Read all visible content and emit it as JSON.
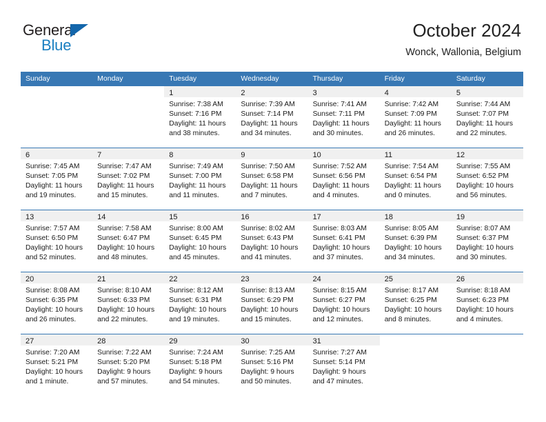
{
  "brand": {
    "name_part1": "General",
    "name_part2": "Blue",
    "triangle_color": "#1366ab",
    "blue_text_color": "#1a7fc1"
  },
  "header": {
    "title": "October 2024",
    "subtitle": "Wonck, Wallonia, Belgium"
  },
  "theme": {
    "header_row_color": "#3878b4",
    "week_divider_color": "#3878b4",
    "daynum_band_color": "#f0f0f0",
    "text_color": "#1a1a1a"
  },
  "calendar": {
    "weekday_headers": [
      "Sunday",
      "Monday",
      "Tuesday",
      "Wednesday",
      "Thursday",
      "Friday",
      "Saturday"
    ],
    "weeks": [
      [
        {
          "day": "",
          "sunrise": "",
          "sunset": "",
          "daylight_line1": "",
          "daylight_line2": ""
        },
        {
          "day": "",
          "sunrise": "",
          "sunset": "",
          "daylight_line1": "",
          "daylight_line2": ""
        },
        {
          "day": "1",
          "sunrise": "Sunrise: 7:38 AM",
          "sunset": "Sunset: 7:16 PM",
          "daylight_line1": "Daylight: 11 hours",
          "daylight_line2": "and 38 minutes."
        },
        {
          "day": "2",
          "sunrise": "Sunrise: 7:39 AM",
          "sunset": "Sunset: 7:14 PM",
          "daylight_line1": "Daylight: 11 hours",
          "daylight_line2": "and 34 minutes."
        },
        {
          "day": "3",
          "sunrise": "Sunrise: 7:41 AM",
          "sunset": "Sunset: 7:11 PM",
          "daylight_line1": "Daylight: 11 hours",
          "daylight_line2": "and 30 minutes."
        },
        {
          "day": "4",
          "sunrise": "Sunrise: 7:42 AM",
          "sunset": "Sunset: 7:09 PM",
          "daylight_line1": "Daylight: 11 hours",
          "daylight_line2": "and 26 minutes."
        },
        {
          "day": "5",
          "sunrise": "Sunrise: 7:44 AM",
          "sunset": "Sunset: 7:07 PM",
          "daylight_line1": "Daylight: 11 hours",
          "daylight_line2": "and 22 minutes."
        }
      ],
      [
        {
          "day": "6",
          "sunrise": "Sunrise: 7:45 AM",
          "sunset": "Sunset: 7:05 PM",
          "daylight_line1": "Daylight: 11 hours",
          "daylight_line2": "and 19 minutes."
        },
        {
          "day": "7",
          "sunrise": "Sunrise: 7:47 AM",
          "sunset": "Sunset: 7:02 PM",
          "daylight_line1": "Daylight: 11 hours",
          "daylight_line2": "and 15 minutes."
        },
        {
          "day": "8",
          "sunrise": "Sunrise: 7:49 AM",
          "sunset": "Sunset: 7:00 PM",
          "daylight_line1": "Daylight: 11 hours",
          "daylight_line2": "and 11 minutes."
        },
        {
          "day": "9",
          "sunrise": "Sunrise: 7:50 AM",
          "sunset": "Sunset: 6:58 PM",
          "daylight_line1": "Daylight: 11 hours",
          "daylight_line2": "and 7 minutes."
        },
        {
          "day": "10",
          "sunrise": "Sunrise: 7:52 AM",
          "sunset": "Sunset: 6:56 PM",
          "daylight_line1": "Daylight: 11 hours",
          "daylight_line2": "and 4 minutes."
        },
        {
          "day": "11",
          "sunrise": "Sunrise: 7:54 AM",
          "sunset": "Sunset: 6:54 PM",
          "daylight_line1": "Daylight: 11 hours",
          "daylight_line2": "and 0 minutes."
        },
        {
          "day": "12",
          "sunrise": "Sunrise: 7:55 AM",
          "sunset": "Sunset: 6:52 PM",
          "daylight_line1": "Daylight: 10 hours",
          "daylight_line2": "and 56 minutes."
        }
      ],
      [
        {
          "day": "13",
          "sunrise": "Sunrise: 7:57 AM",
          "sunset": "Sunset: 6:50 PM",
          "daylight_line1": "Daylight: 10 hours",
          "daylight_line2": "and 52 minutes."
        },
        {
          "day": "14",
          "sunrise": "Sunrise: 7:58 AM",
          "sunset": "Sunset: 6:47 PM",
          "daylight_line1": "Daylight: 10 hours",
          "daylight_line2": "and 48 minutes."
        },
        {
          "day": "15",
          "sunrise": "Sunrise: 8:00 AM",
          "sunset": "Sunset: 6:45 PM",
          "daylight_line1": "Daylight: 10 hours",
          "daylight_line2": "and 45 minutes."
        },
        {
          "day": "16",
          "sunrise": "Sunrise: 8:02 AM",
          "sunset": "Sunset: 6:43 PM",
          "daylight_line1": "Daylight: 10 hours",
          "daylight_line2": "and 41 minutes."
        },
        {
          "day": "17",
          "sunrise": "Sunrise: 8:03 AM",
          "sunset": "Sunset: 6:41 PM",
          "daylight_line1": "Daylight: 10 hours",
          "daylight_line2": "and 37 minutes."
        },
        {
          "day": "18",
          "sunrise": "Sunrise: 8:05 AM",
          "sunset": "Sunset: 6:39 PM",
          "daylight_line1": "Daylight: 10 hours",
          "daylight_line2": "and 34 minutes."
        },
        {
          "day": "19",
          "sunrise": "Sunrise: 8:07 AM",
          "sunset": "Sunset: 6:37 PM",
          "daylight_line1": "Daylight: 10 hours",
          "daylight_line2": "and 30 minutes."
        }
      ],
      [
        {
          "day": "20",
          "sunrise": "Sunrise: 8:08 AM",
          "sunset": "Sunset: 6:35 PM",
          "daylight_line1": "Daylight: 10 hours",
          "daylight_line2": "and 26 minutes."
        },
        {
          "day": "21",
          "sunrise": "Sunrise: 8:10 AM",
          "sunset": "Sunset: 6:33 PM",
          "daylight_line1": "Daylight: 10 hours",
          "daylight_line2": "and 22 minutes."
        },
        {
          "day": "22",
          "sunrise": "Sunrise: 8:12 AM",
          "sunset": "Sunset: 6:31 PM",
          "daylight_line1": "Daylight: 10 hours",
          "daylight_line2": "and 19 minutes."
        },
        {
          "day": "23",
          "sunrise": "Sunrise: 8:13 AM",
          "sunset": "Sunset: 6:29 PM",
          "daylight_line1": "Daylight: 10 hours",
          "daylight_line2": "and 15 minutes."
        },
        {
          "day": "24",
          "sunrise": "Sunrise: 8:15 AM",
          "sunset": "Sunset: 6:27 PM",
          "daylight_line1": "Daylight: 10 hours",
          "daylight_line2": "and 12 minutes."
        },
        {
          "day": "25",
          "sunrise": "Sunrise: 8:17 AM",
          "sunset": "Sunset: 6:25 PM",
          "daylight_line1": "Daylight: 10 hours",
          "daylight_line2": "and 8 minutes."
        },
        {
          "day": "26",
          "sunrise": "Sunrise: 8:18 AM",
          "sunset": "Sunset: 6:23 PM",
          "daylight_line1": "Daylight: 10 hours",
          "daylight_line2": "and 4 minutes."
        }
      ],
      [
        {
          "day": "27",
          "sunrise": "Sunrise: 7:20 AM",
          "sunset": "Sunset: 5:21 PM",
          "daylight_line1": "Daylight: 10 hours",
          "daylight_line2": "and 1 minute."
        },
        {
          "day": "28",
          "sunrise": "Sunrise: 7:22 AM",
          "sunset": "Sunset: 5:20 PM",
          "daylight_line1": "Daylight: 9 hours",
          "daylight_line2": "and 57 minutes."
        },
        {
          "day": "29",
          "sunrise": "Sunrise: 7:24 AM",
          "sunset": "Sunset: 5:18 PM",
          "daylight_line1": "Daylight: 9 hours",
          "daylight_line2": "and 54 minutes."
        },
        {
          "day": "30",
          "sunrise": "Sunrise: 7:25 AM",
          "sunset": "Sunset: 5:16 PM",
          "daylight_line1": "Daylight: 9 hours",
          "daylight_line2": "and 50 minutes."
        },
        {
          "day": "31",
          "sunrise": "Sunrise: 7:27 AM",
          "sunset": "Sunset: 5:14 PM",
          "daylight_line1": "Daylight: 9 hours",
          "daylight_line2": "and 47 minutes."
        },
        {
          "day": "",
          "sunrise": "",
          "sunset": "",
          "daylight_line1": "",
          "daylight_line2": ""
        },
        {
          "day": "",
          "sunrise": "",
          "sunset": "",
          "daylight_line1": "",
          "daylight_line2": ""
        }
      ]
    ]
  }
}
